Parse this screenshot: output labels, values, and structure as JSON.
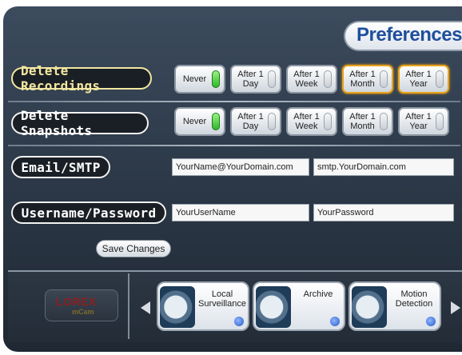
{
  "title": "Preferences",
  "rows": {
    "delete_recordings": {
      "label": "Delete Recordings",
      "options": [
        "Never",
        "After 1 Day",
        "After 1 Week",
        "After 1 Month",
        "After 1 Year"
      ]
    },
    "delete_snapshots": {
      "label": "Delete Snapshots",
      "options": [
        "Never",
        "After 1 Day",
        "After 1 Week",
        "After 1 Month",
        "After 1 Year"
      ]
    },
    "email": {
      "label": "Email/SMTP",
      "email_value": "YourName@YourDomain.com",
      "smtp_value": "smtp.YourDomain.com"
    },
    "credentials": {
      "label": "Username/Password",
      "username_value": "YourUserName",
      "password_value": "YourPassword"
    }
  },
  "save_label": "Save Changes",
  "logo": {
    "brand": "LOREX",
    "sub": "mCam"
  },
  "nav_cards": [
    {
      "label": "Local Surveillance",
      "icon": "camera-dome-icon"
    },
    {
      "label": "Archive",
      "icon": "film-reel-icon"
    },
    {
      "label": "Motion Detection",
      "icon": "motion-figure-icon"
    }
  ],
  "colors": {
    "title": "#1f4f9c",
    "accent": "#e9a21a",
    "toggle_on": "#2fb62a"
  }
}
